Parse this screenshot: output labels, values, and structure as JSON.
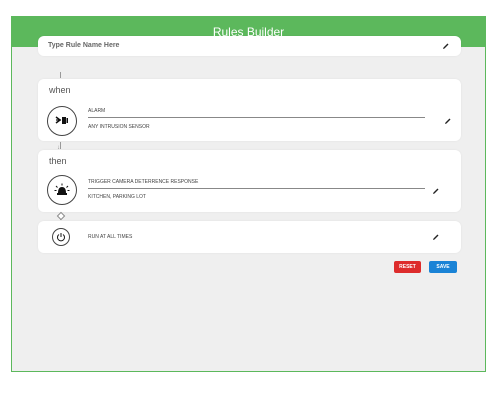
{
  "header": {
    "title": "Rules Builder"
  },
  "rule_name": {
    "placeholder": "Type Rule Name Here"
  },
  "when": {
    "label": "when",
    "event_type": "ALARM",
    "event_detail": "ANY INTRUSION SENSOR"
  },
  "then": {
    "label": "then",
    "action": "TRIGGER CAMERA DETERRENCE RESPONSE",
    "action_detail": "KITCHEN, PARKING LOT"
  },
  "schedule": {
    "label": "RUN AT ALL TIMES"
  },
  "buttons": {
    "reset": "RESET",
    "save": "SAVE"
  },
  "colors": {
    "header": "#5cb85c",
    "reset": "#dd2c2c",
    "save": "#1a83d6"
  }
}
